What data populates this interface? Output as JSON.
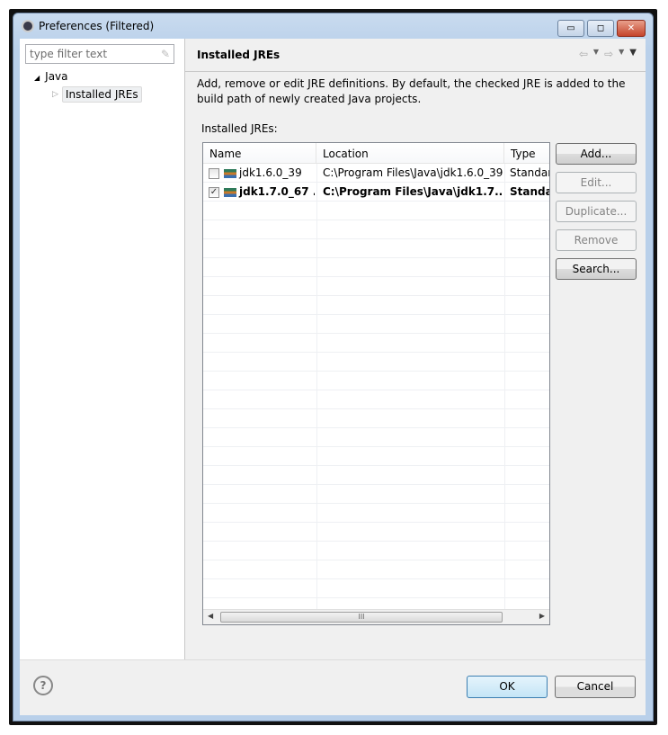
{
  "window": {
    "title": "Preferences (Filtered)",
    "minimize": "▭",
    "maximize": "◻",
    "close": "✕"
  },
  "sidebar": {
    "filter_placeholder": "type filter text",
    "tree": [
      {
        "label": "Java",
        "expanded": true
      },
      {
        "label": "Installed JREs",
        "selected": true
      }
    ]
  },
  "page": {
    "title": "Installed JREs",
    "description": "Add, remove or edit JRE definitions. By default, the checked JRE is added to the build path of newly created Java projects.",
    "table_label": "Installed JREs:"
  },
  "table": {
    "columns": [
      "Name",
      "Location",
      "Type"
    ],
    "rows": [
      {
        "checked": false,
        "name": "jdk1.6.0_39",
        "location": "C:\\Program Files\\Java\\jdk1.6.0_39",
        "type": "Standard VM",
        "bold": false
      },
      {
        "checked": true,
        "name": "jdk1.7.0_67 ...",
        "location": "C:\\Program Files\\Java\\jdk1.7....",
        "type": "Standard VM",
        "bold": true
      }
    ],
    "scroll_grip": "III"
  },
  "buttons": {
    "add": "Add...",
    "edit": "Edit...",
    "duplicate": "Duplicate...",
    "remove": "Remove",
    "search": "Search..."
  },
  "footer": {
    "help": "?",
    "ok": "OK",
    "cancel": "Cancel"
  }
}
